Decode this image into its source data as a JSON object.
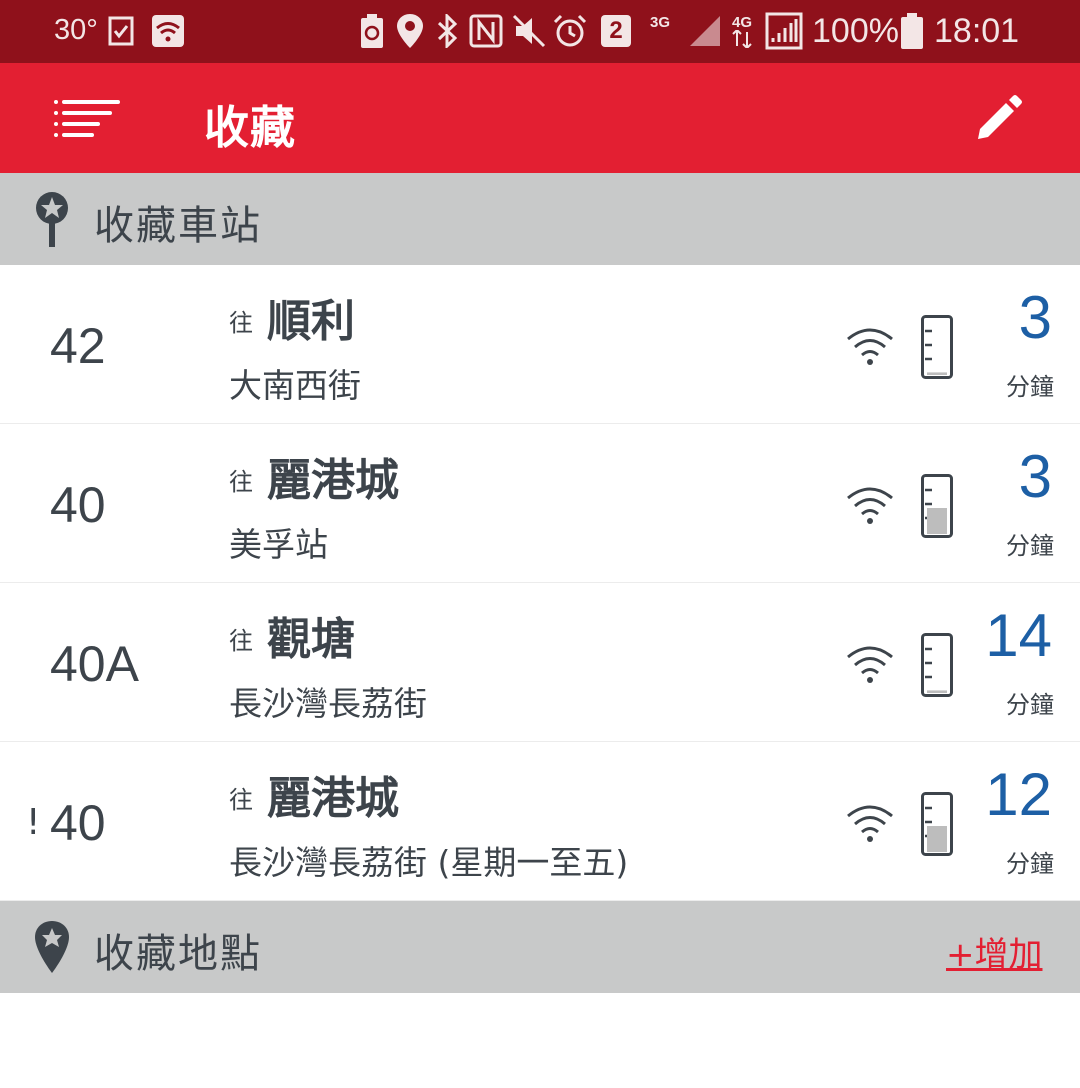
{
  "status_bar": {
    "temperature": "30°",
    "notification_badge": "2",
    "network_3g": "3G",
    "network_4g": "4G",
    "battery": "100%",
    "time": "18:01"
  },
  "app_bar": {
    "title": "收藏"
  },
  "favorite_stops": {
    "header": "收藏車站",
    "items": [
      {
        "alert": "",
        "route": "42",
        "to_prefix": "往",
        "destination": "順利",
        "stop": "大南西街",
        "eta": "3",
        "eta_unit": "分鐘",
        "load_level": 0.05
      },
      {
        "alert": "",
        "route": "40",
        "to_prefix": "往",
        "destination": "麗港城",
        "stop": "美孚站",
        "eta": "3",
        "eta_unit": "分鐘",
        "load_level": 0.5
      },
      {
        "alert": "",
        "route": "40A",
        "to_prefix": "往",
        "destination": "觀塘",
        "stop": "長沙灣長荔街",
        "eta": "14",
        "eta_unit": "分鐘",
        "load_level": 0.05
      },
      {
        "alert": "!",
        "route": "40",
        "to_prefix": "往",
        "destination": "麗港城",
        "stop": "長沙灣長荔街 (星期一至五)",
        "eta": "12",
        "eta_unit": "分鐘",
        "load_level": 0.5
      }
    ]
  },
  "favorite_places": {
    "header": "收藏地點",
    "add_label": "+增加"
  },
  "colors": {
    "status_bar": "#8f111b",
    "app_bar": "#e31f32",
    "section_header": "#c8c9c9",
    "eta": "#1d5fa5",
    "text": "#3d444b"
  }
}
